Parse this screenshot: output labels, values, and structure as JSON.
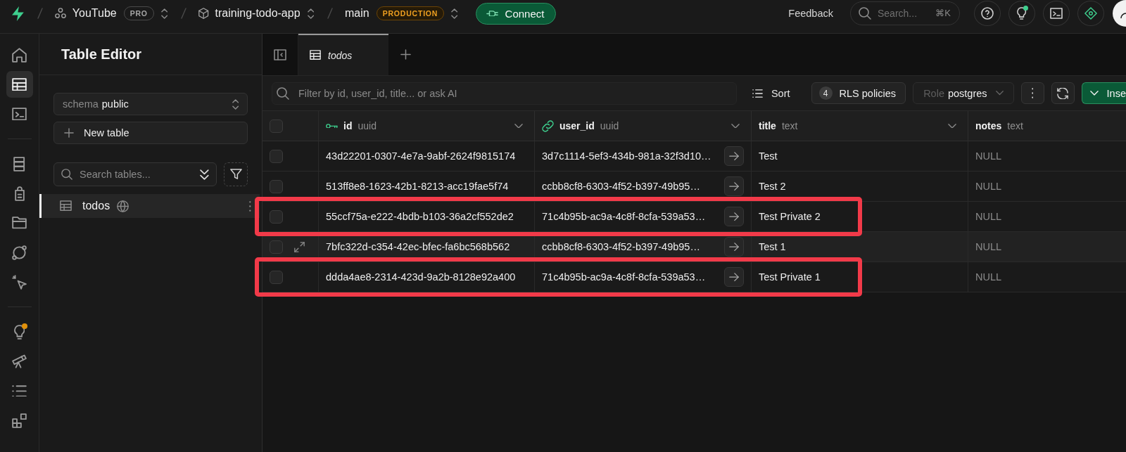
{
  "top_bar": {
    "organization": {
      "name": "YouTube",
      "badge": "PRO"
    },
    "project": {
      "name": "training-todo-app"
    },
    "branch": {
      "name": "main",
      "badge": "PRODUCTION"
    },
    "connect_button": "Connect",
    "feedback_button": "Feedback",
    "search": {
      "placeholder": "Search...",
      "shortcut": "⌘K"
    },
    "icon_buttons": [
      {
        "notification": false
      },
      {
        "notification": true
      },
      {
        "notification": false
      },
      {
        "notification": false
      }
    ]
  },
  "rail": {
    "groups": [
      {
        "items": [
          {
            "selected": false,
            "notification": false
          },
          {
            "selected": true,
            "notification": false
          },
          {
            "selected": false,
            "notification": false
          }
        ]
      },
      {
        "items": [
          {
            "selected": false,
            "notification": false
          },
          {
            "selected": false,
            "notification": false
          },
          {
            "selected": false,
            "notification": false
          },
          {
            "selected": false,
            "notification": false
          },
          {
            "selected": false,
            "notification": false
          }
        ]
      },
      {
        "items": [
          {
            "selected": false,
            "notification": true
          },
          {
            "selected": false,
            "notification": false
          },
          {
            "selected": false,
            "notification": false
          },
          {
            "selected": false,
            "notification": false
          }
        ]
      }
    ]
  },
  "sidebar": {
    "title": "Table Editor",
    "schema_select": {
      "label": "schema",
      "value": "public"
    },
    "new_table_button": "New table",
    "search": {
      "placeholder": "Search tables..."
    },
    "tables": [
      {
        "name": "todos",
        "selected": true
      }
    ]
  },
  "tabs": [
    {
      "label": "todos",
      "selected": true
    }
  ],
  "toolbar": {
    "filter": {
      "placeholder": "Filter by id, user_id, title... or ask AI"
    },
    "sort_button": "Sort",
    "rls_button": {
      "count": "4",
      "label": "RLS policies"
    },
    "role_select": {
      "label": "Role",
      "value": "postgres"
    },
    "insert_button": "Inse"
  },
  "table": {
    "select_all_checked": false,
    "columns": [
      {
        "name": "id",
        "type": "uuid",
        "kind": "primary_key",
        "chevron": true
      },
      {
        "name": "user_id",
        "type": "uuid",
        "kind": "foreign_key",
        "chevron": true
      },
      {
        "name": "title",
        "type": "text",
        "kind": "plain",
        "chevron": true
      },
      {
        "name": "notes",
        "type": "text",
        "kind": "plain",
        "chevron": false
      }
    ],
    "rows": [
      {
        "selected": false,
        "hovered": false,
        "highlighted": false,
        "cells": [
          {
            "text": "43d22201-0307-4e7a-9abf-2624f9815174",
            "null": false
          },
          {
            "text": "3d7c1114-5ef3-434b-981a-32f3d10…",
            "null": false
          },
          {
            "text": "Test",
            "null": false
          },
          {
            "text": "NULL",
            "null": true
          }
        ]
      },
      {
        "selected": false,
        "hovered": false,
        "highlighted": false,
        "cells": [
          {
            "text": "513ff8e8-1623-42b1-8213-acc19fae5f74",
            "null": false
          },
          {
            "text": "ccbb8cf8-6303-4f52-b397-49b95…",
            "null": false
          },
          {
            "text": "Test 2",
            "null": false
          },
          {
            "text": "NULL",
            "null": true
          }
        ]
      },
      {
        "selected": false,
        "hovered": false,
        "highlighted": true,
        "cells": [
          {
            "text": "55ccf75a-e222-4bdb-b103-36a2cf552de2",
            "null": false
          },
          {
            "text": "71c4b95b-ac9a-4c8f-8cfa-539a53…",
            "null": false
          },
          {
            "text": "Test Private 2",
            "null": false
          },
          {
            "text": "NULL",
            "null": true
          }
        ]
      },
      {
        "selected": false,
        "hovered": true,
        "highlighted": false,
        "cells": [
          {
            "text": "7bfc322d-c354-42ec-bfec-fa6bc568b562",
            "null": false
          },
          {
            "text": "ccbb8cf8-6303-4f52-b397-49b95…",
            "null": false
          },
          {
            "text": "Test 1",
            "null": false
          },
          {
            "text": "NULL",
            "null": true
          }
        ]
      },
      {
        "selected": false,
        "hovered": false,
        "highlighted": true,
        "cells": [
          {
            "text": "ddda4ae8-2314-423d-9a2b-8128e92a400",
            "null": false
          },
          {
            "text": "71c4b95b-ac9a-4c8f-8cfa-539a53…",
            "null": false
          },
          {
            "text": "Test Private 1",
            "null": false
          },
          {
            "text": "NULL",
            "null": true
          }
        ]
      }
    ]
  }
}
